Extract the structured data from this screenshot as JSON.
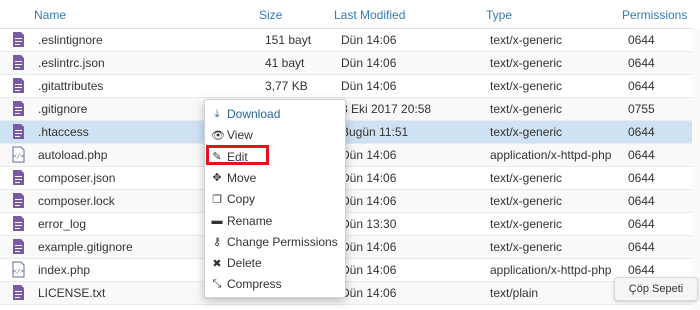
{
  "header": {
    "name": "Name",
    "size": "Size",
    "modified": "Last Modified",
    "type": "Type",
    "permissions": "Permissions"
  },
  "rows": [
    {
      "name": ".eslintignore",
      "size": "151 bayt",
      "modified": "Dün 14:06",
      "type": "text/x-generic",
      "perm": "0644",
      "icon": "generic-file-icon"
    },
    {
      "name": ".eslintrc.json",
      "size": "41 bayt",
      "modified": "Dün 14:06",
      "type": "text/x-generic",
      "perm": "0644",
      "icon": "generic-file-icon"
    },
    {
      "name": ".gitattributes",
      "size": "3,77 KB",
      "modified": "Dün 14:06",
      "type": "text/x-generic",
      "perm": "0644",
      "icon": "generic-file-icon"
    },
    {
      "name": ".gitignore",
      "size": "",
      "modified": "8 Eki 2017 20:58",
      "type": "text/x-generic",
      "perm": "0755",
      "icon": "generic-file-icon"
    },
    {
      "name": ".htaccess",
      "size": "",
      "modified": "Bugün 11:51",
      "type": "text/x-generic",
      "perm": "0644",
      "icon": "generic-file-icon"
    },
    {
      "name": "autoload.php",
      "size": "",
      "modified": "Dün 14:06",
      "type": "application/x-httpd-php",
      "perm": "0644",
      "icon": "php-file-icon"
    },
    {
      "name": "composer.json",
      "size": "",
      "modified": "Dün 14:06",
      "type": "text/x-generic",
      "perm": "0644",
      "icon": "generic-file-icon"
    },
    {
      "name": "composer.lock",
      "size": "",
      "modified": "Dün 14:06",
      "type": "text/x-generic",
      "perm": "0644",
      "icon": "generic-file-icon"
    },
    {
      "name": "error_log",
      "size": "",
      "modified": "Dün 13:30",
      "type": "text/x-generic",
      "perm": "0644",
      "icon": "generic-file-icon"
    },
    {
      "name": "example.gitignore",
      "size": "",
      "modified": "Dün 14:06",
      "type": "text/x-generic",
      "perm": "0644",
      "icon": "generic-file-icon"
    },
    {
      "name": "index.php",
      "size": "",
      "modified": "Dün 14:06",
      "type": "application/x-httpd-php",
      "perm": "0644",
      "icon": "php-file-icon"
    },
    {
      "name": "LICENSE.txt",
      "size": "",
      "modified": "Dün 14:06",
      "type": "text/plain",
      "perm": "0644",
      "icon": "generic-file-icon"
    }
  ],
  "selected_row": ".htaccess",
  "context_menu": [
    {
      "label": "Download",
      "icon": "download-icon",
      "glyph": "⤓"
    },
    {
      "label": "View",
      "icon": "eye-icon",
      "glyph": "👁"
    },
    {
      "label": "Edit",
      "icon": "pencil-icon",
      "glyph": "✎"
    },
    {
      "label": "Move",
      "icon": "move-icon",
      "glyph": "✥"
    },
    {
      "label": "Copy",
      "icon": "copy-icon",
      "glyph": "❐"
    },
    {
      "label": "Rename",
      "icon": "file-icon",
      "glyph": "▬"
    },
    {
      "label": "Change Permissions",
      "icon": "key-icon",
      "glyph": "⚷"
    },
    {
      "label": "Delete",
      "icon": "delete-icon",
      "glyph": "✖"
    },
    {
      "label": "Compress",
      "icon": "compress-icon",
      "glyph": "⤡"
    }
  ],
  "trash_label": "Çöp Sepeti",
  "colors": {
    "accent": "#337ab7",
    "selected": "#cfe2f3",
    "highlight_border": "#e5121a",
    "icon_generic": "#7a5aa6",
    "icon_php": "#5b6f9a"
  }
}
